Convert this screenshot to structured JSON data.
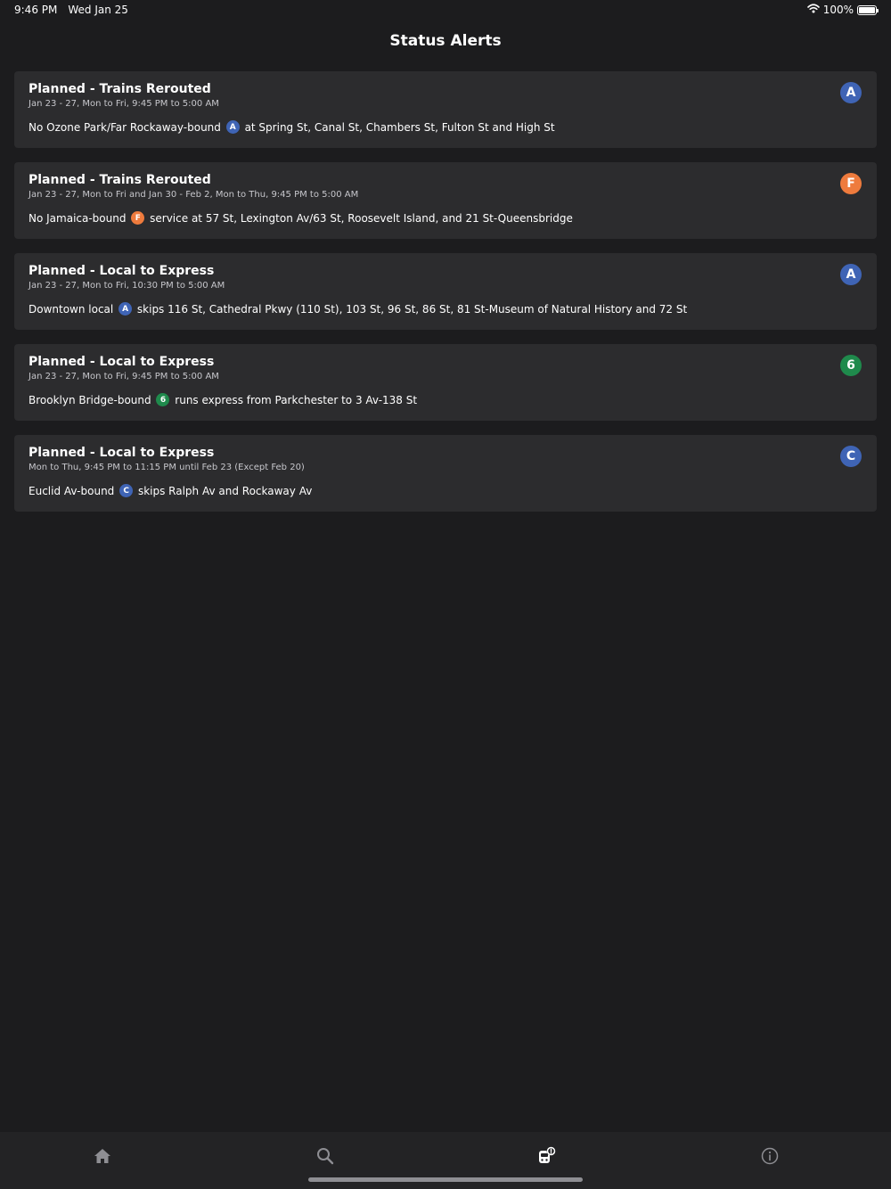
{
  "status_bar": {
    "time": "9:46 PM",
    "date": "Wed Jan 25",
    "battery": "100%",
    "battery_level": 1.0
  },
  "header": {
    "title": "Status Alerts"
  },
  "colors": {
    "A": "#3f64b5",
    "C": "#3f64b5",
    "F": "#ee7b3d",
    "6": "#1f8a4c",
    "tab_active": "#ffffff",
    "tab_inactive": "#8e8e93"
  },
  "alerts": [
    {
      "title": "Planned - Trains Rerouted",
      "date": "Jan 23 - 27, Mon to Fri, 9:45 PM to 5:00 AM",
      "line": "A",
      "desc_before": "No Ozone Park/Far Rockaway-bound",
      "desc_after": "at Spring St, Canal St, Chambers St, Fulton St and High St"
    },
    {
      "title": "Planned - Trains Rerouted",
      "date": "Jan 23 - 27, Mon to Fri and Jan 30 - Feb 2, Mon to Thu, 9:45 PM to 5:00 AM",
      "line": "F",
      "desc_before": "No Jamaica-bound",
      "desc_after": "service at 57 St, Lexington Av/63 St, Roosevelt Island, and 21 St-Queensbridge"
    },
    {
      "title": "Planned - Local to Express",
      "date": "Jan 23 - 27, Mon to Fri, 10:30 PM to 5:00 AM",
      "line": "A",
      "desc_before": "Downtown local",
      "desc_after": "skips 116 St, Cathedral Pkwy (110 St), 103 St, 96 St, 86 St, 81 St-Museum of Natural History and 72 St"
    },
    {
      "title": "Planned - Local to Express",
      "date": "Jan 23 - 27, Mon to Fri, 9:45 PM to 5:00 AM",
      "line": "6",
      "desc_before": "Brooklyn Bridge-bound",
      "desc_after": "runs express from Parkchester to 3 Av-138 St"
    },
    {
      "title": "Planned - Local to Express",
      "date": "Mon to Thu, 9:45 PM to 11:15 PM until Feb 23 (Except Feb 20)",
      "line": "C",
      "desc_before": "Euclid Av-bound",
      "desc_after": "skips Ralph Av and Rockaway Av"
    }
  ],
  "tab_bar": {
    "tabs": [
      {
        "icon": "home-icon",
        "active": false
      },
      {
        "icon": "search-icon",
        "active": false
      },
      {
        "icon": "status-alerts-icon",
        "active": true
      },
      {
        "icon": "info-icon",
        "active": false
      }
    ]
  }
}
